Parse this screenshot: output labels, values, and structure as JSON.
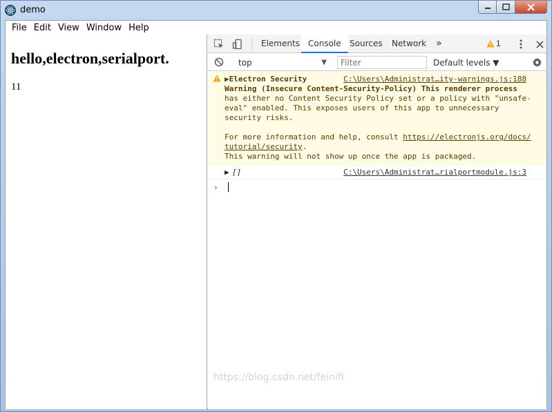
{
  "window": {
    "title": "demo"
  },
  "menu": [
    "File",
    "Edit",
    "View",
    "Window",
    "Help"
  ],
  "page": {
    "heading": "hello,electron,serialport.",
    "value": "11"
  },
  "devtools": {
    "tabs": [
      "Elements",
      "Console",
      "Sources",
      "Network"
    ],
    "active_tab": "Console",
    "more_tabs": "»",
    "warning_count": "1",
    "context": "top",
    "filter_placeholder": "Filter",
    "levels": "Default levels ▼",
    "messages": {
      "warning": {
        "lines": [
          "Electron Security",
          "Warning (Insecure Content-Security-Policy) This renderer process",
          "has either no Content Security Policy set or a policy with \"unsafe-",
          "eval\" enabled. This exposes users of this app to unnecessary",
          "security risks.",
          "",
          "For more information and help, consult ",
          "tutorial/security",
          "This warning will not show up once the app is packaged."
        ],
        "link_start": "https://electronjs.org/docs/",
        "source": "C:\\Users\\Administrat…ity-warnings.js:188"
      },
      "log": {
        "text": "[]",
        "source": "C:\\Users\\Administrat…rialportmodule.js:3"
      }
    }
  },
  "watermark": "https://blog.csdn.net/feinifi",
  "colors": {
    "accent": "#1a73e8",
    "warning_bg": "#fffbe5",
    "warning_text": "#5c3c00"
  }
}
